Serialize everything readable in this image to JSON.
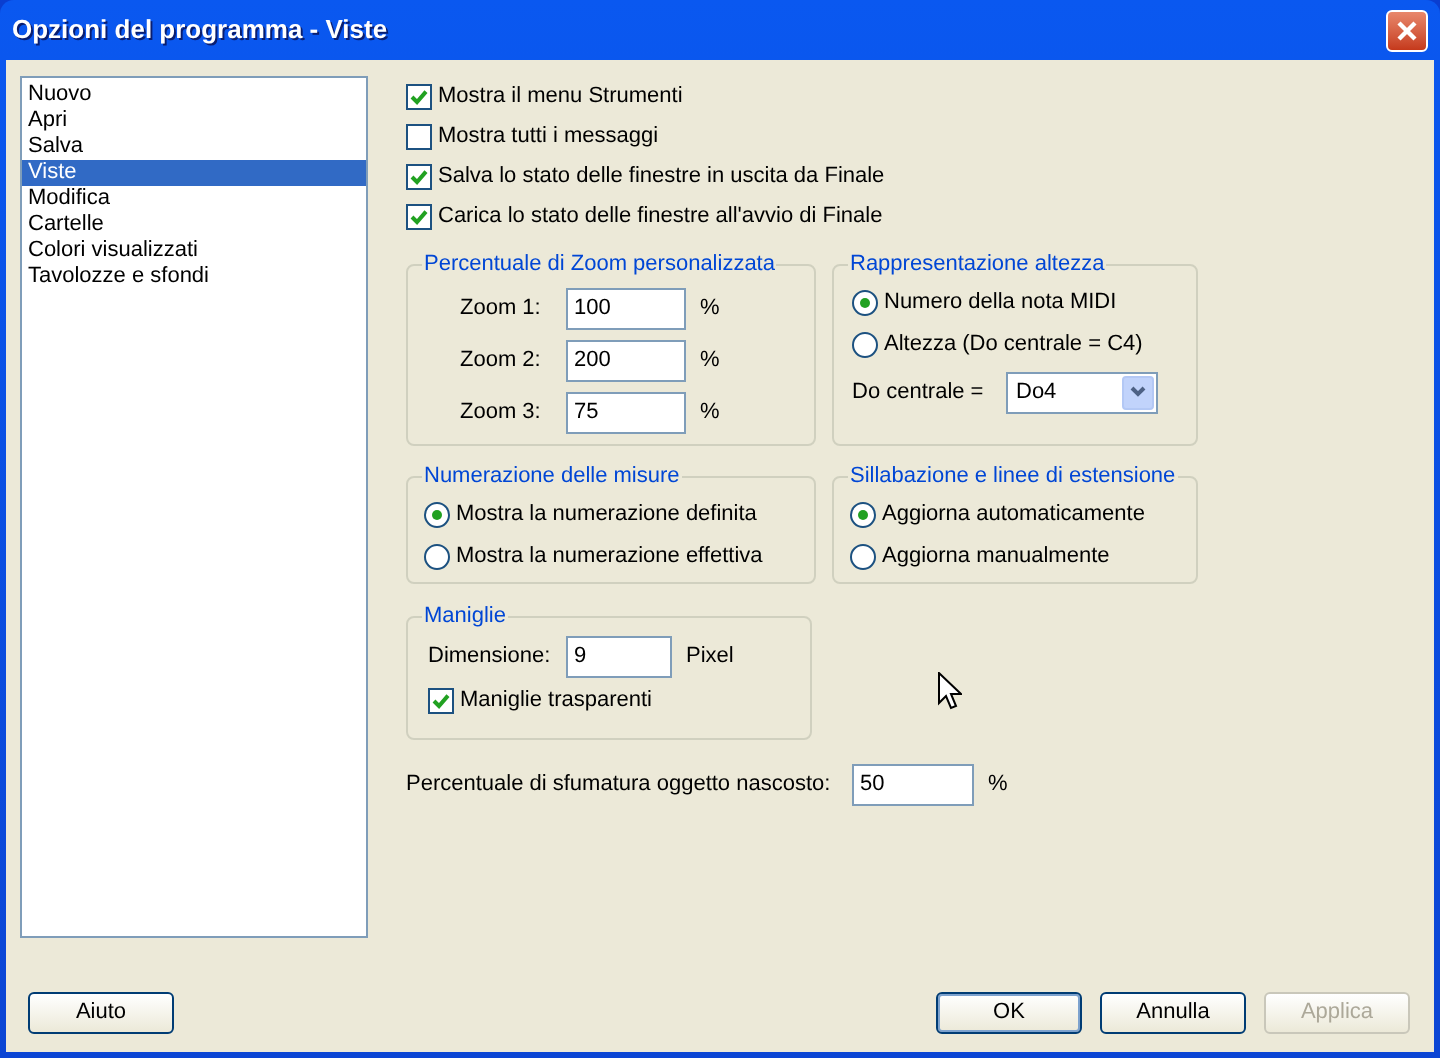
{
  "window": {
    "title": "Opzioni del programma - Viste"
  },
  "categories": [
    {
      "label": "Nuovo",
      "selected": false
    },
    {
      "label": "Apri",
      "selected": false
    },
    {
      "label": "Salva",
      "selected": false
    },
    {
      "label": "Viste",
      "selected": true
    },
    {
      "label": "Modifica",
      "selected": false
    },
    {
      "label": "Cartelle",
      "selected": false
    },
    {
      "label": "Colori visualizzati",
      "selected": false
    },
    {
      "label": "Tavolozze e sfondi",
      "selected": false
    }
  ],
  "general_options": [
    {
      "label": "Mostra il menu Strumenti",
      "checked": true
    },
    {
      "label": "Mostra tutti i messaggi",
      "checked": false
    },
    {
      "label": "Salva lo stato delle finestre in uscita da Finale",
      "checked": true
    },
    {
      "label": "Carica lo stato delle finestre all'avvio di Finale",
      "checked": true
    }
  ],
  "zoom_group": {
    "title": "Percentuale di Zoom personalizzata",
    "fields": [
      {
        "label": "Zoom 1:",
        "value": "100",
        "unit": "%"
      },
      {
        "label": "Zoom 2:",
        "value": "200",
        "unit": "%"
      },
      {
        "label": "Zoom 3:",
        "value": "75",
        "unit": "%"
      }
    ]
  },
  "pitch_group": {
    "title": "Rappresentazione altezza",
    "options": [
      {
        "label": "Numero della nota MIDI",
        "selected": true
      },
      {
        "label": "Altezza (Do centrale = C4)",
        "selected": false
      }
    ],
    "middle_c": {
      "label": "Do centrale =",
      "value": "Do4"
    }
  },
  "measure_numbering": {
    "title": "Numerazione delle misure",
    "options": [
      {
        "label": "Mostra la numerazione definita",
        "selected": true
      },
      {
        "label": "Mostra la numerazione effettiva",
        "selected": false
      }
    ]
  },
  "syllabation": {
    "title": "Sillabazione e linee di estensione",
    "options": [
      {
        "label": "Aggiorna automaticamente",
        "selected": true
      },
      {
        "label": "Aggiorna manualmente",
        "selected": false
      }
    ]
  },
  "handles": {
    "title": "Maniglie",
    "size": {
      "label": "Dimensione:",
      "value": "9",
      "unit": "Pixel"
    },
    "transparent": {
      "label": "Maniglie trasparenti",
      "checked": true
    }
  },
  "hidden_shade": {
    "label": "Percentuale di sfumatura oggetto nascosto:",
    "value": "50",
    "unit": "%"
  },
  "buttons": [
    {
      "label": "Aiuto",
      "default": false,
      "disabled": false
    },
    {
      "label": "OK",
      "default": true,
      "disabled": false
    },
    {
      "label": "Annulla",
      "default": false,
      "disabled": false
    },
    {
      "label": "Applica",
      "default": false,
      "disabled": true
    }
  ]
}
